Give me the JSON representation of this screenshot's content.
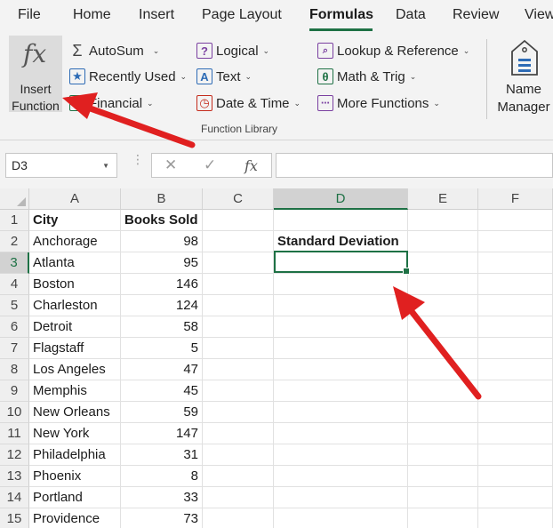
{
  "menu_tabs": [
    "File",
    "Home",
    "Insert",
    "Page Layout",
    "Formulas",
    "Data",
    "Review",
    "View"
  ],
  "active_tab": "Formulas",
  "ribbon": {
    "insert_function": {
      "line1": "Insert",
      "line2": "Function",
      "icon": "fx"
    },
    "col1": [
      {
        "label": "AutoSum",
        "icon": "sigma-icon"
      },
      {
        "label": "Recently Used",
        "icon": "star-icon"
      },
      {
        "label": "Financial",
        "icon": "financial-icon"
      }
    ],
    "col2": [
      {
        "label": "Logical",
        "icon": "question-icon"
      },
      {
        "label": "Text",
        "icon": "text-a-icon"
      },
      {
        "label": "Date & Time",
        "icon": "clock-icon"
      }
    ],
    "col3": [
      {
        "label": "Lookup & Reference",
        "icon": "magnifier-icon"
      },
      {
        "label": "Math & Trig",
        "icon": "theta-icon"
      },
      {
        "label": "More Functions",
        "icon": "more-functions-icon"
      }
    ],
    "group_label": "Function Library",
    "name_manager": {
      "line1": "Name",
      "line2": "Manager"
    }
  },
  "formula_bar": {
    "name_box": "D3",
    "cancel": "✕",
    "enter": "✓",
    "fx": "fx",
    "content": ""
  },
  "grid": {
    "columns": [
      "A",
      "B",
      "C",
      "D",
      "E",
      "F"
    ],
    "selected_column": "D",
    "selected_row": "3",
    "rows": [
      {
        "n": "1",
        "a": "City",
        "b": "Books Sold",
        "d": ""
      },
      {
        "n": "2",
        "a": "Anchorage",
        "b": "98",
        "d": "Standard Deviation"
      },
      {
        "n": "3",
        "a": "Atlanta",
        "b": "95",
        "d": ""
      },
      {
        "n": "4",
        "a": "Boston",
        "b": "146",
        "d": ""
      },
      {
        "n": "5",
        "a": "Charleston",
        "b": "124",
        "d": ""
      },
      {
        "n": "6",
        "a": "Detroit",
        "b": "58",
        "d": ""
      },
      {
        "n": "7",
        "a": "Flagstaff",
        "b": "5",
        "d": ""
      },
      {
        "n": "8",
        "a": "Los Angeles",
        "b": "47",
        "d": ""
      },
      {
        "n": "9",
        "a": "Memphis",
        "b": "45",
        "d": ""
      },
      {
        "n": "10",
        "a": "New Orleans",
        "b": "59",
        "d": ""
      },
      {
        "n": "11",
        "a": "New York",
        "b": "147",
        "d": ""
      },
      {
        "n": "12",
        "a": "Philadelphia",
        "b": "31",
        "d": ""
      },
      {
        "n": "13",
        "a": "Phoenix",
        "b": "8",
        "d": ""
      },
      {
        "n": "14",
        "a": "Portland",
        "b": "33",
        "d": ""
      },
      {
        "n": "15",
        "a": "Providence",
        "b": "73",
        "d": ""
      }
    ]
  },
  "colors": {
    "accent": "#1e7145",
    "arrow": "#e02020"
  }
}
